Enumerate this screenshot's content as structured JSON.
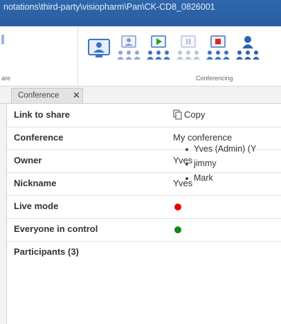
{
  "window": {
    "path": "notations\\third-party\\visiopharm\\Pan\\CK-CD8_0826001"
  },
  "ribbon": {
    "left_group_caption": "are",
    "group_caption": "Conferencing",
    "buttons": [
      {
        "icon": "conference-window-icon"
      },
      {
        "icon": "presenter-audience-icon"
      },
      {
        "icon": "start-presentation-icon"
      },
      {
        "icon": "pause-presentation-icon"
      },
      {
        "icon": "stop-presentation-icon"
      },
      {
        "icon": "participants-icon"
      }
    ],
    "colors": {
      "accent": "#3a74c6",
      "green": "#2aa02a",
      "red": "#d12a2a"
    }
  },
  "tab": {
    "label": "Conference",
    "close": "✕"
  },
  "properties": [
    {
      "key": "Link to share",
      "value": "Copy"
    },
    {
      "key": "Conference",
      "value": "My conference"
    },
    {
      "key": "Owner",
      "value": "Yves"
    },
    {
      "key": "Nickname",
      "value": "Yves"
    },
    {
      "key": "Live mode",
      "value_color": "#ee0000"
    },
    {
      "key": "Everyone in control",
      "value_color": "#118811"
    },
    {
      "key": "Participants (3)"
    }
  ],
  "participants": [
    "Yves (Admin) (Y",
    "jimmy",
    "Mark"
  ]
}
